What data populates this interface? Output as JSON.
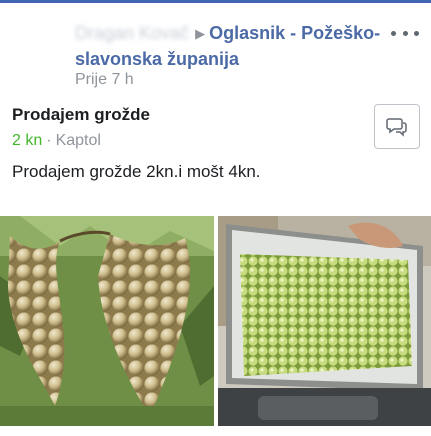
{
  "post": {
    "author_name": "Dragan Kovač",
    "arrow": "▶",
    "group_name": "Oglasnik - Požeško-slavonska županija",
    "timestamp": "Prije 7 h"
  },
  "listing": {
    "title": "Prodajem grožde",
    "price": "2 kn",
    "separator": "·",
    "location": "Kaptol",
    "description": "Prodajem grožde 2kn.i mošt 4kn."
  },
  "icons": {
    "more": "more-horizontal-icon",
    "message": "message-bubble-icon"
  },
  "colors": {
    "accent": "#4267b2",
    "group_link": "#4b6aa6",
    "price": "#42b72a",
    "meta": "#90949c"
  }
}
